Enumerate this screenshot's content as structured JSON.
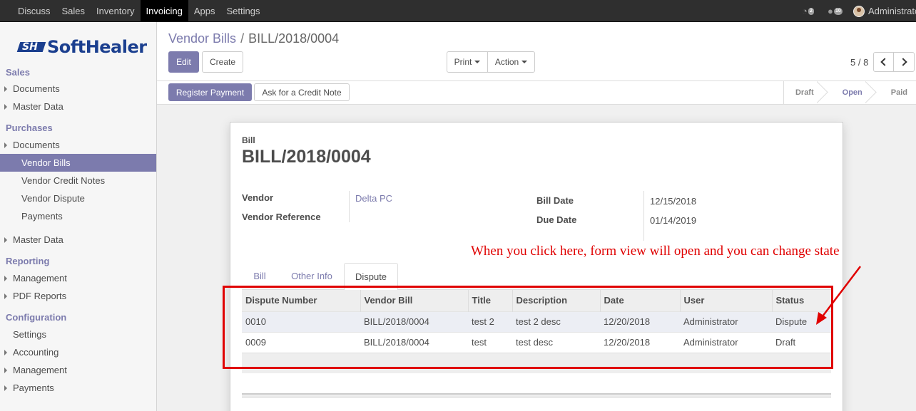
{
  "topbar": {
    "menu": [
      "Discuss",
      "Sales",
      "Inventory",
      "Invoicing",
      "Apps",
      "Settings"
    ],
    "active_menu": "Invoicing",
    "activity_badge": "2",
    "messages_badge": "10",
    "user": "Administrator"
  },
  "sidebar": {
    "logo_text": "SoftHealer",
    "sections": {
      "sales": "Sales",
      "sales_documents": "Documents",
      "sales_master": "Master Data",
      "purchases": "Purchases",
      "purchases_documents": "Documents",
      "vendor_bills": "Vendor Bills",
      "vendor_credit_notes": "Vendor Credit Notes",
      "vendor_dispute": "Vendor Dispute",
      "payments": "Payments",
      "purchases_master": "Master Data",
      "reporting": "Reporting",
      "rep_management": "Management",
      "pdf_reports": "PDF Reports",
      "configuration": "Configuration",
      "settings": "Settings",
      "accounting": "Accounting",
      "conf_management": "Management",
      "conf_payments": "Payments"
    }
  },
  "breadcrumb": {
    "parent": "Vendor Bills",
    "separator": "/",
    "current": "BILL/2018/0004"
  },
  "buttons": {
    "edit": "Edit",
    "create": "Create",
    "print": "Print",
    "action": "Action",
    "register_payment": "Register Payment",
    "credit_note": "Ask for a Credit Note"
  },
  "pager": {
    "value": "5 / 8"
  },
  "statusbar": {
    "stages": [
      "Draft",
      "Open",
      "Paid"
    ],
    "current": "Open"
  },
  "form": {
    "bill_label": "Bill",
    "bill_name": "BILL/2018/0004",
    "vendor_label": "Vendor",
    "vendor_value": "Delta PC",
    "vendor_ref_label": "Vendor Reference",
    "bill_date_label": "Bill Date",
    "bill_date_value": "12/15/2018",
    "due_date_label": "Due Date",
    "due_date_value": "01/14/2019"
  },
  "annotation": "When you click here, form view will open and you can change state",
  "tabs": [
    "Bill",
    "Other Info",
    "Dispute"
  ],
  "active_tab": "Dispute",
  "dispute_table": {
    "columns": [
      "Dispute Number",
      "Vendor Bill",
      "Title",
      "Description",
      "Date",
      "User",
      "Status"
    ],
    "rows": [
      [
        "0010",
        "BILL/2018/0004",
        "test 2",
        "test 2 desc",
        "12/20/2018",
        "Administrator",
        "Dispute"
      ],
      [
        "0009",
        "BILL/2018/0004",
        "test",
        "test desc",
        "12/20/2018",
        "Administrator",
        "Draft"
      ]
    ]
  },
  "colors": {
    "accent": "#7c7bad",
    "annotation": "#e00000",
    "topbar": "#2f2f2f"
  }
}
